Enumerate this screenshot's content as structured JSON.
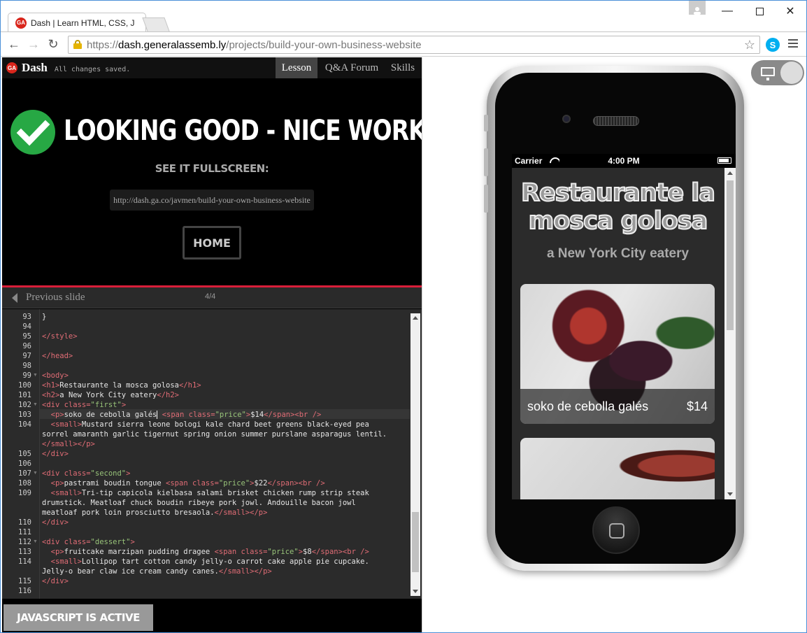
{
  "browser": {
    "tab_title": "Dash | Learn HTML, CSS, J",
    "url_scheme": "https://",
    "url_host": "dash.generalassemb.ly",
    "url_path": "/projects/build-your-own-business-website",
    "favicon_text": "GA"
  },
  "dash": {
    "logo_text": "GA",
    "name": "Dash",
    "save_status": "All changes saved.",
    "nav": {
      "lesson": "Lesson",
      "qa": "Q&A Forum",
      "skills": "Skills"
    },
    "headline": "LOOKING GOOD - NICE WORK!",
    "see_fullscreen": "SEE IT FULLSCREEN:",
    "fullscreen_url": "http://dash.ga.co/javmen/build-your-own-business-website",
    "home_button": "HOME",
    "previous_slide": "Previous slide",
    "slide_counter": "4/4",
    "js_status": "JAVASCRIPT IS ACTIVE"
  },
  "editor": {
    "line_numbers": [
      "93",
      "94",
      "95",
      "96",
      "97",
      "98",
      "99",
      "100",
      "101",
      "102",
      "103",
      "104",
      "",
      "",
      "105",
      "106",
      "107",
      "108",
      "109",
      "",
      "",
      "110",
      "111",
      "112",
      "113",
      "114",
      "",
      "115",
      "116"
    ],
    "folded_lines": [
      "99",
      "102",
      "107",
      "112"
    ]
  },
  "phone": {
    "carrier": "Carrier",
    "time": "4:00 PM",
    "site_title": "Restaurante la mosca golosa",
    "site_subtitle": "a New York City eatery",
    "card1_name": "soko de cebolla galés",
    "card1_price": "$14"
  }
}
